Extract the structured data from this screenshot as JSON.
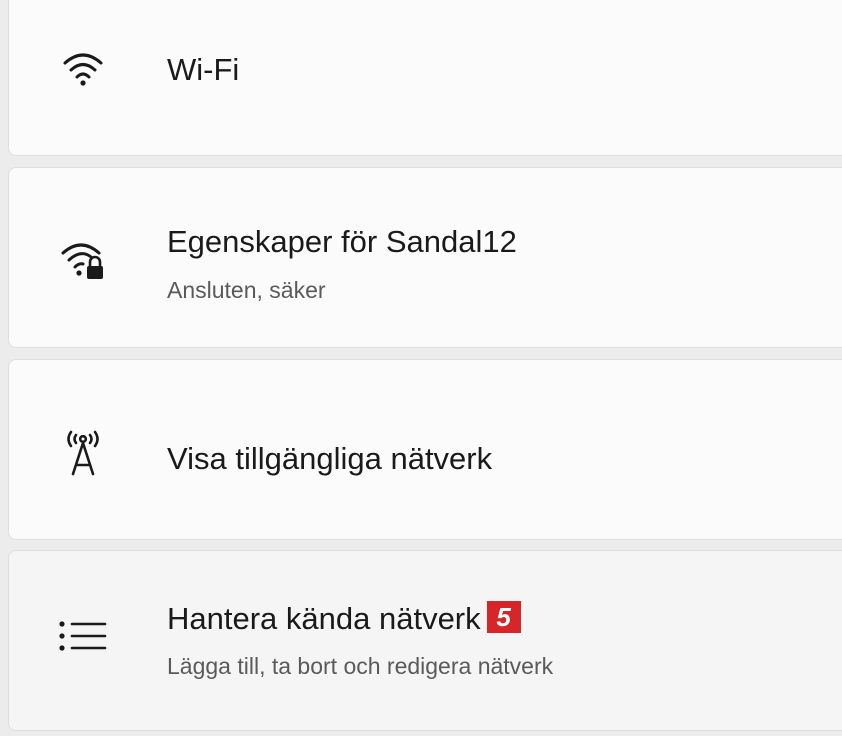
{
  "settings": {
    "items": [
      {
        "title": "Wi-Fi",
        "icon": "wifi-icon"
      },
      {
        "title": "Egenskaper för Sandal12",
        "subtitle": "Ansluten, säker",
        "icon": "wifi-lock-icon"
      },
      {
        "title": "Visa tillgängliga nätverk",
        "icon": "antenna-icon"
      },
      {
        "title": "Hantera kända nätverk",
        "subtitle": "Lägga till, ta bort och redigera nätverk",
        "icon": "list-icon",
        "badge": "5"
      }
    ]
  },
  "colors": {
    "badge": "#d6262a",
    "card": "#fbfbfb",
    "background": "#ececec"
  }
}
